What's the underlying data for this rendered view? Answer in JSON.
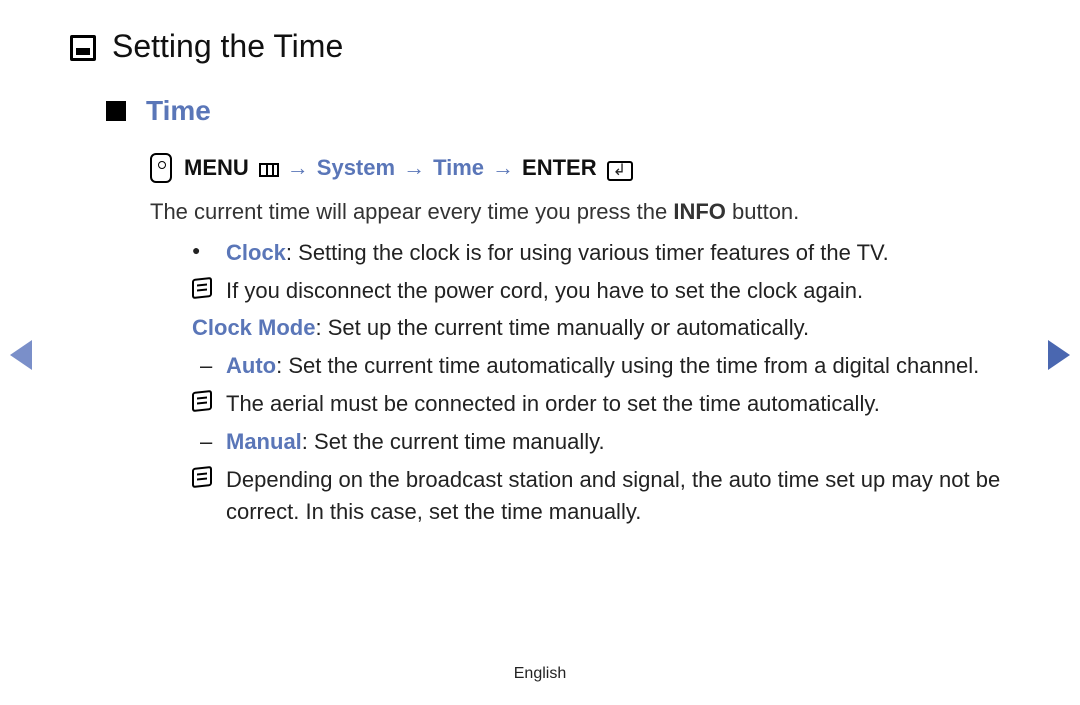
{
  "title": "Setting the Time",
  "section": "Time",
  "path": {
    "menu": "MENU",
    "p1": "System",
    "p2": "Time",
    "enter": "ENTER",
    "arrow": "→"
  },
  "intro_pre": "The current time will appear every time you press the ",
  "intro_bold": "INFO",
  "intro_post": " button.",
  "clock_label": "Clock",
  "clock_desc": ": Setting the clock is for using various timer features of the TV.",
  "clock_note": "If you disconnect the power cord, you have to set the clock again.",
  "clockmode_label": "Clock Mode",
  "clockmode_desc": ": Set up the current time manually or automatically.",
  "auto_label": "Auto",
  "auto_desc": ": Set the current time automatically using the time from a digital channel.",
  "auto_note": "The aerial must be connected in order to set the time automatically.",
  "manual_label": "Manual",
  "manual_desc": ": Set the current time manually.",
  "manual_note": "Depending on the broadcast station and signal, the auto time set up may not be correct. In this case, set the time manually.",
  "footer": "English"
}
